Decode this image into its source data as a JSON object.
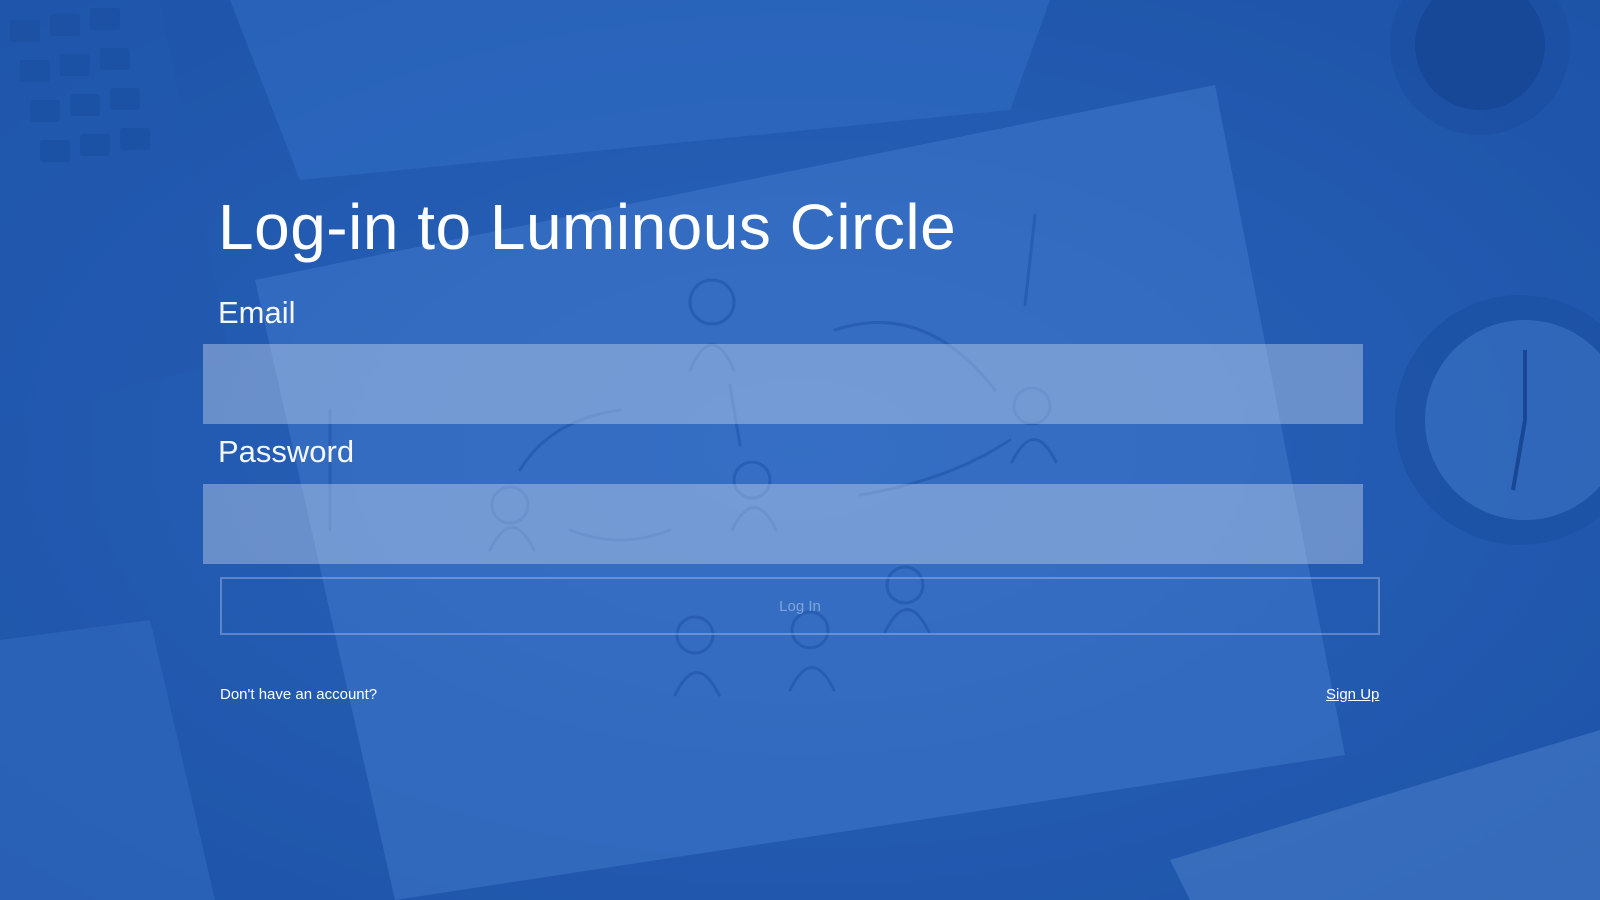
{
  "login": {
    "title": "Log-in to Luminous Circle",
    "email_label": "Email",
    "email_value": "",
    "password_label": "Password",
    "password_value": "",
    "login_button": "Log In",
    "no_account_text": "Don't have an account?",
    "signup_link": "Sign Up"
  },
  "colors": {
    "background_tint": "#2b62b8",
    "text": "#ffffff"
  }
}
